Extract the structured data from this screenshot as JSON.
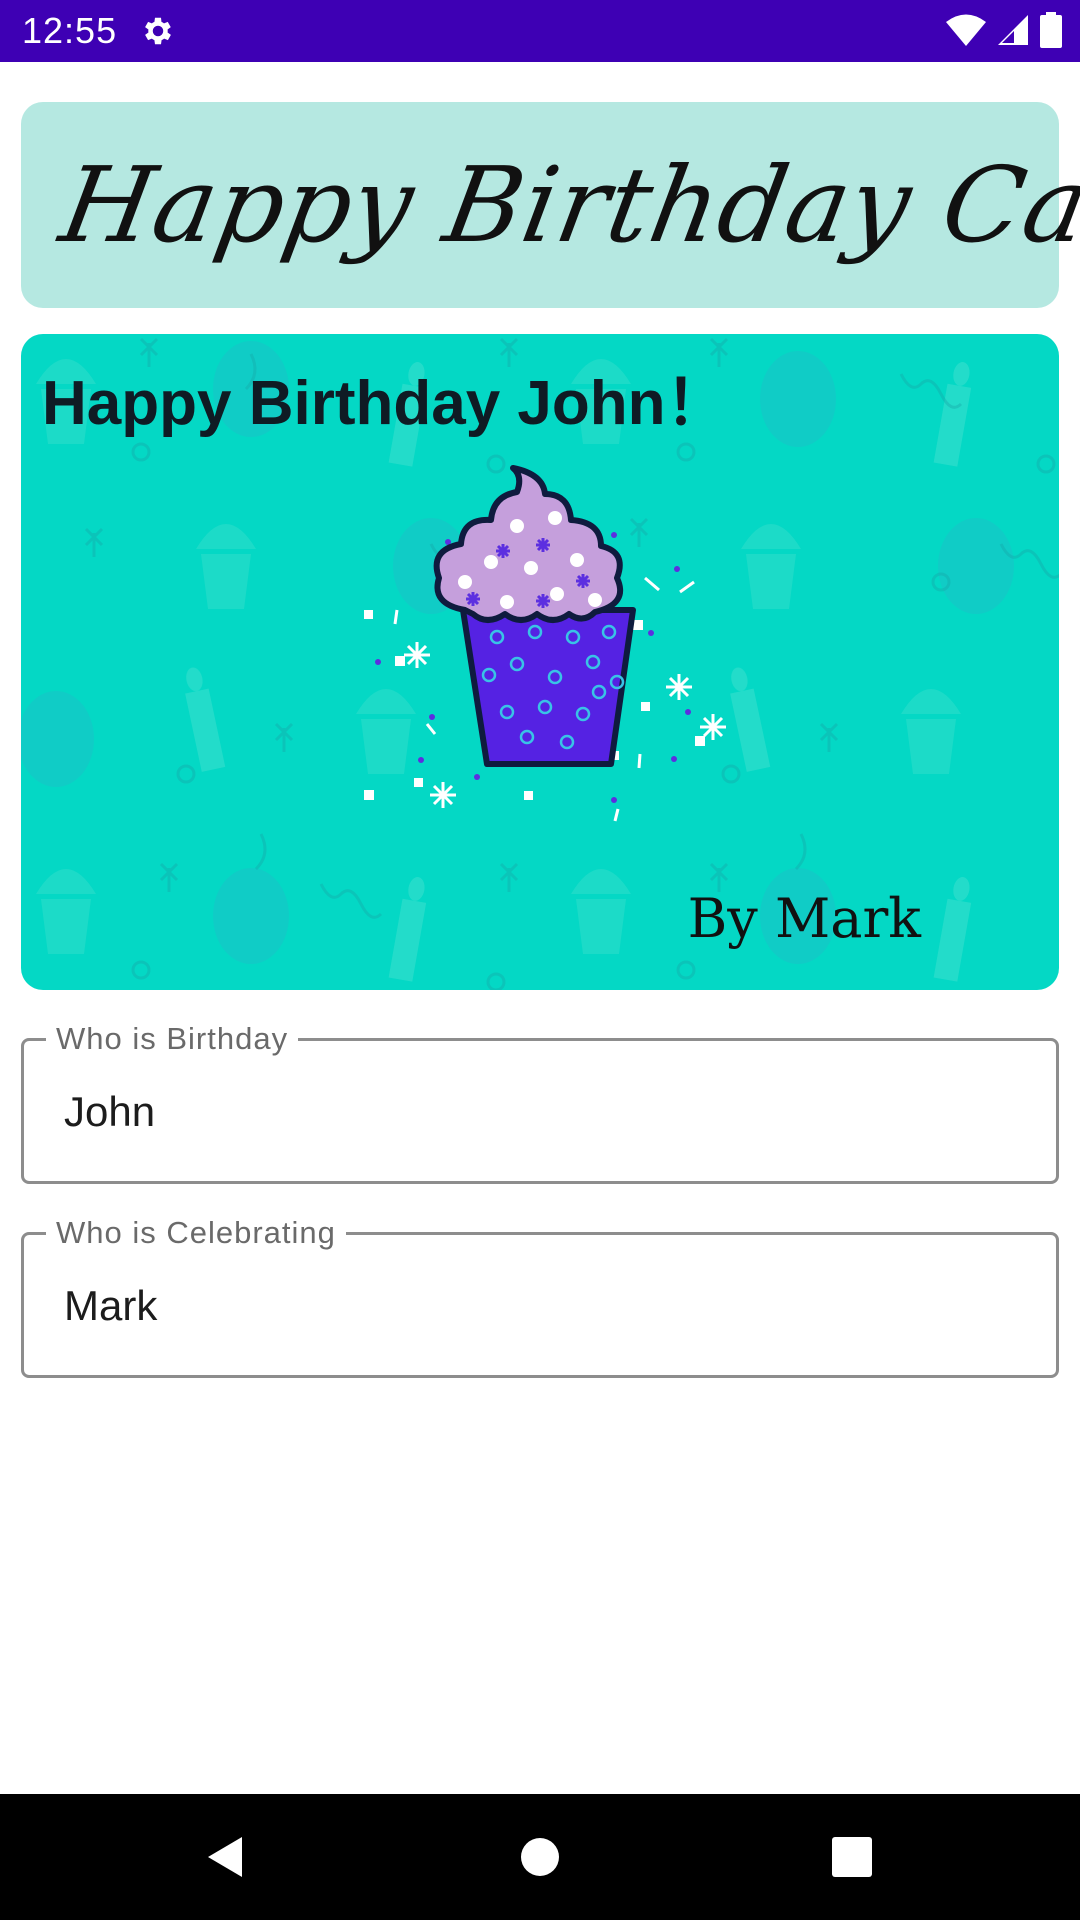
{
  "status_bar": {
    "time": "12:55",
    "icons": [
      "settings-gear-icon",
      "wifi-icon",
      "cellular-signal-icon",
      "battery-icon"
    ],
    "background_color": "#3e00b4"
  },
  "title_card": {
    "title": "Happy Birthday Card",
    "background_color": "#b5e8e1"
  },
  "birthday_card": {
    "greeting": "Happy Birthday John！",
    "signature": "By Mark",
    "background_color": "#04d8c5",
    "illustration": "cupcake-icon"
  },
  "form": {
    "birthday_field": {
      "label": "Who is Birthday",
      "value": "John"
    },
    "celebrating_field": {
      "label": "Who is Celebrating",
      "value": "Mark"
    }
  },
  "nav_bar": {
    "icons": [
      "back-icon",
      "home-icon",
      "recents-icon"
    ]
  }
}
